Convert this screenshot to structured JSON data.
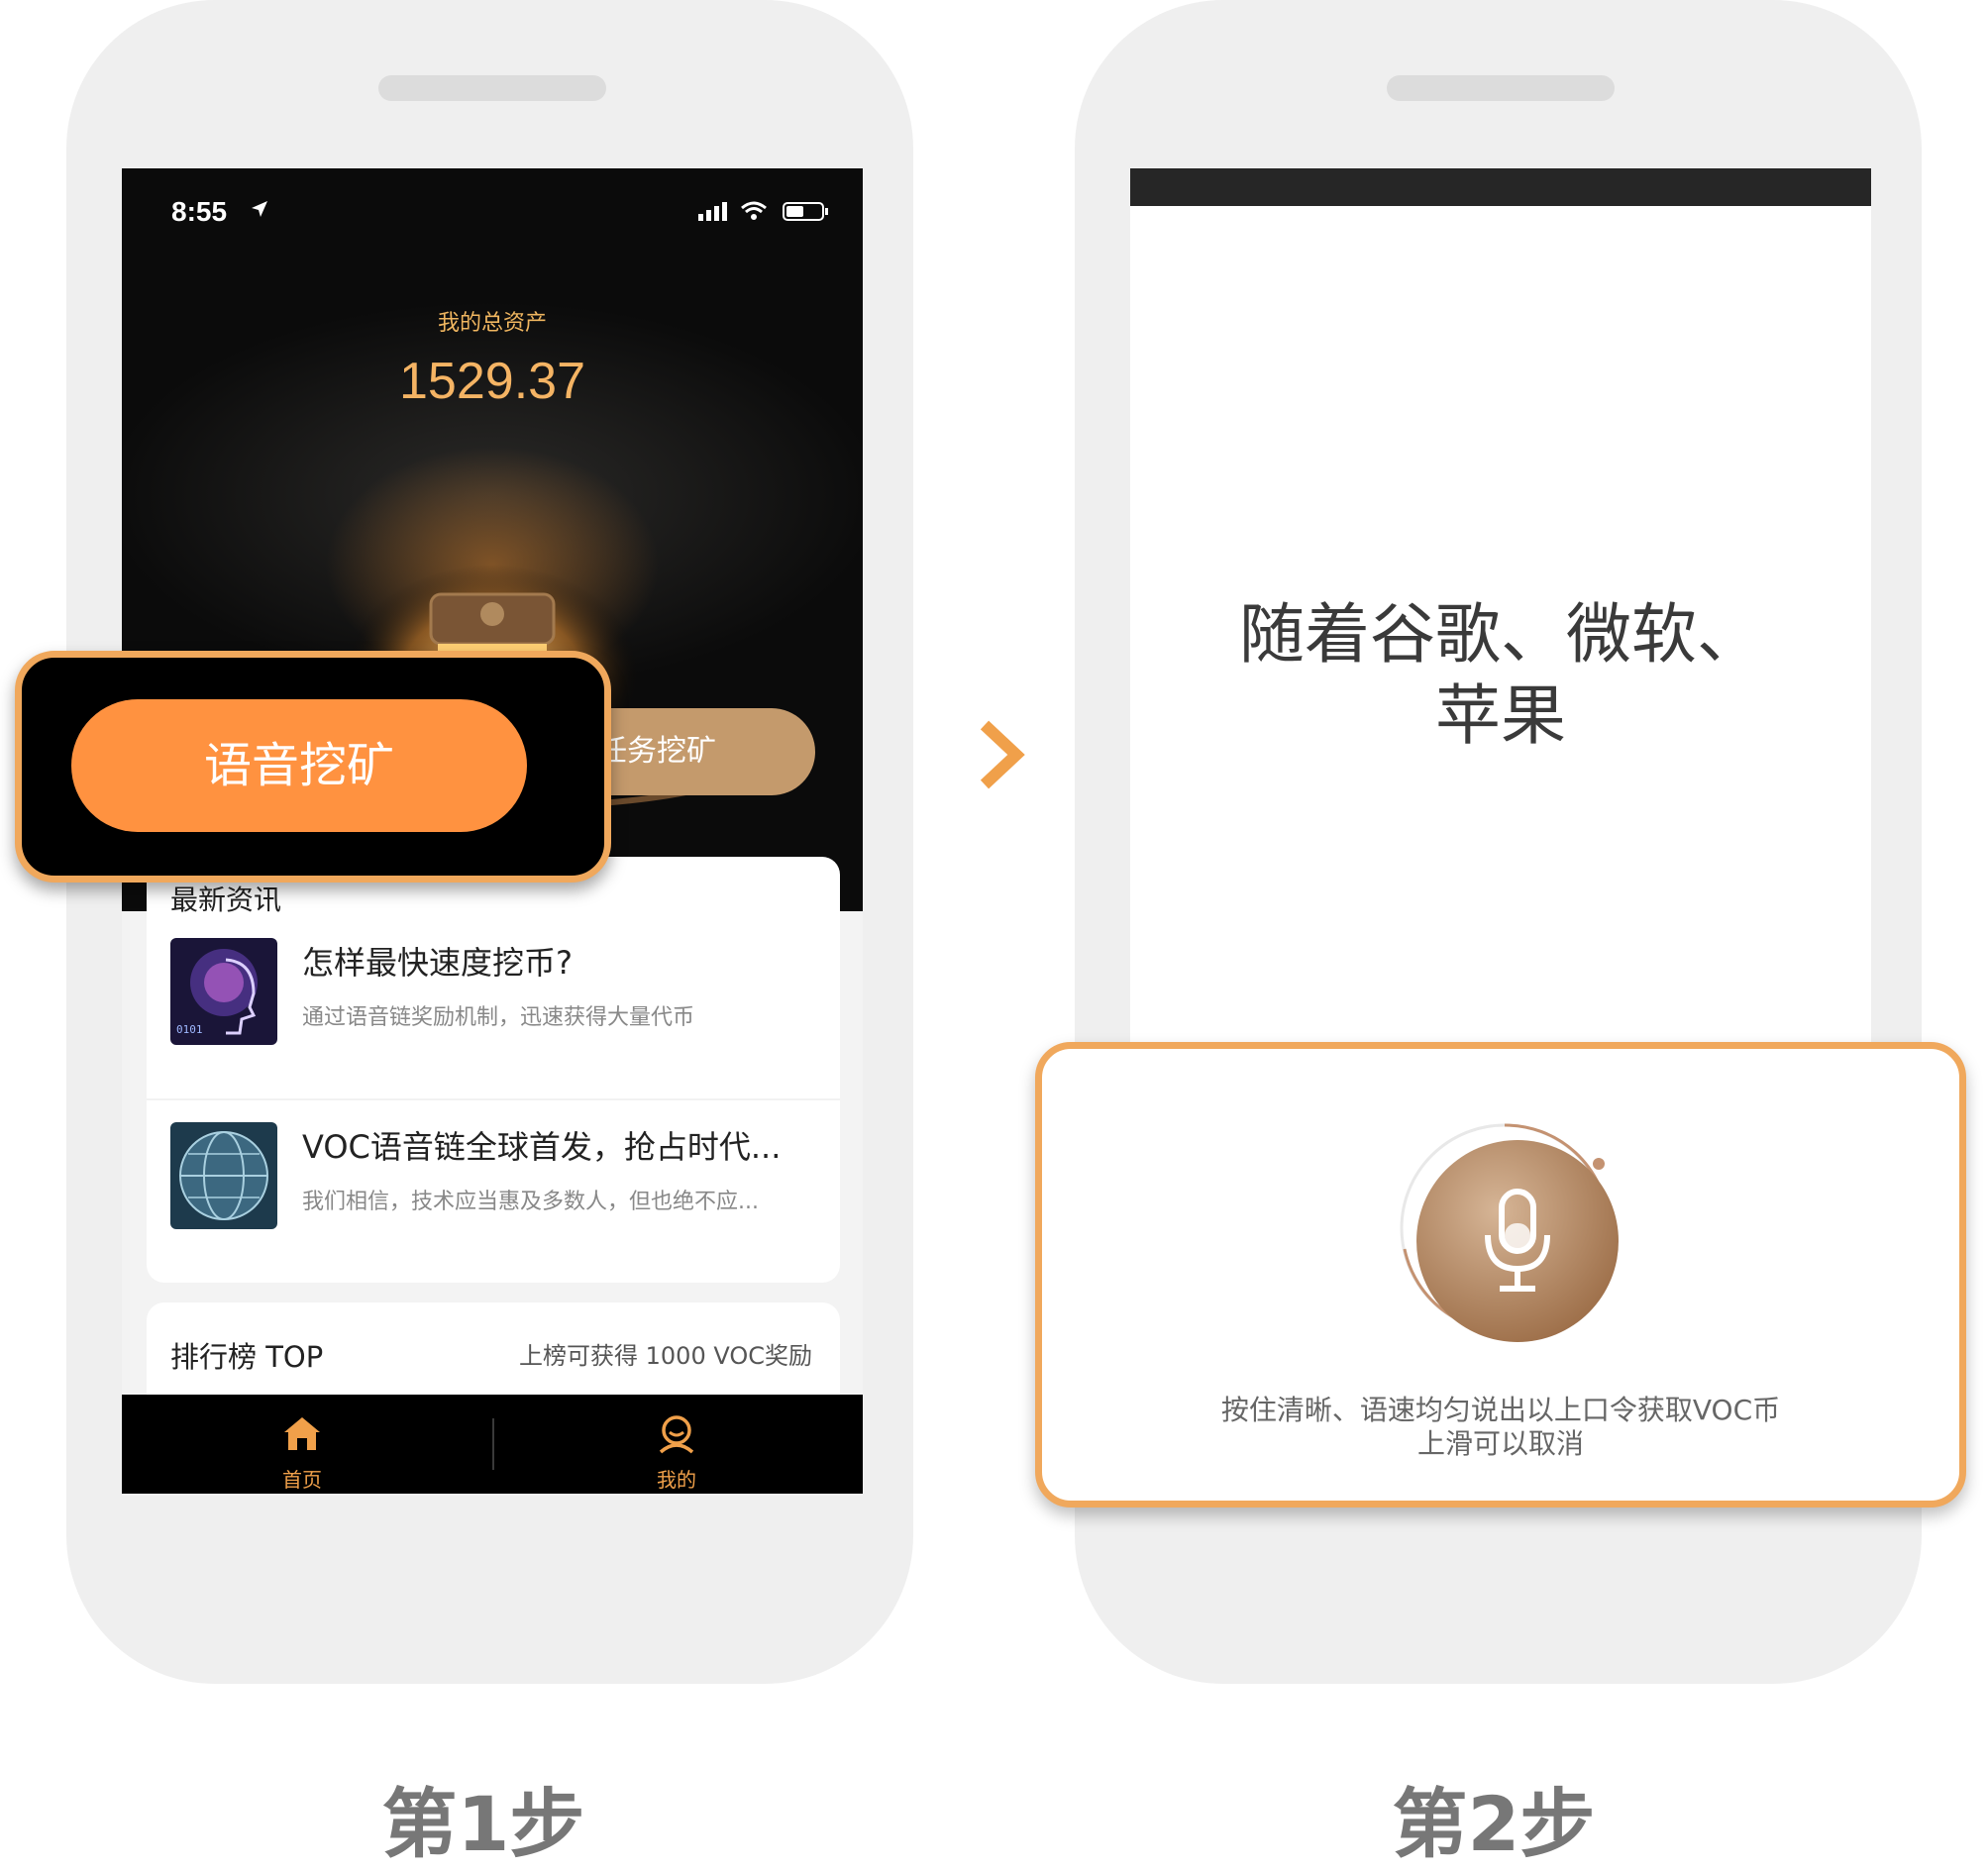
{
  "screen1": {
    "status": {
      "time": "8:55"
    },
    "assets": {
      "label": "我的总资产",
      "value": "1529.37"
    },
    "buttons": {
      "voice_mining": "语音挖矿",
      "task_mining": "任务挖矿"
    },
    "news": {
      "title": "最新资讯",
      "items": [
        {
          "headline": "怎样最快速度挖币?",
          "summary": "通过语音链奖励机制，迅速获得大量代币"
        },
        {
          "headline": "VOC语音链全球首发，抢占时代...",
          "summary": "我们相信，技术应当惠及多数人，但也绝不应..."
        }
      ]
    },
    "ranking": {
      "title": "排行榜 TOP",
      "reward": "上榜可获得 1000 VOC奖励"
    },
    "tabs": [
      {
        "label": "首页",
        "icon": "home-icon"
      },
      {
        "label": "我的",
        "icon": "user-icon"
      }
    ]
  },
  "screen2": {
    "passphrase": {
      "line1": "随着谷歌、微软、",
      "line2": "苹果"
    },
    "instruction": {
      "line1": "按住清晰、语速均匀说出以上口令获取VOC币",
      "line2": "上滑可以取消"
    }
  },
  "steps": {
    "step1": "第1步",
    "step2": "第2步"
  },
  "colors": {
    "accent_orange": "#ff9240",
    "highlight_border": "#f0a85c",
    "task_button": "#c49a6c",
    "asset_gold": "#f5b464",
    "mic_bronze": "#9c6d47"
  }
}
